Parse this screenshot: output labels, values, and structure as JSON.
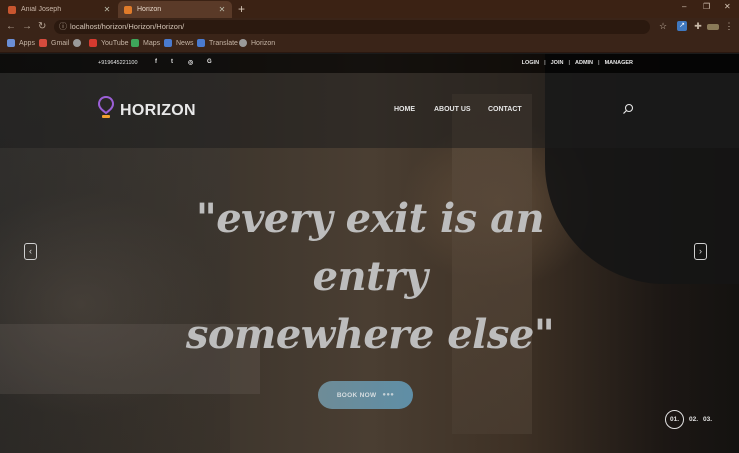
{
  "browser": {
    "tabs": [
      {
        "title": "Anial Joseph",
        "active": false,
        "favicon_color": "#c8562f"
      },
      {
        "title": "Horizon",
        "active": true,
        "favicon_color": "#e07b2a"
      }
    ],
    "new_tab": "+",
    "window_controls": {
      "minimize": "–",
      "maximize": "❐",
      "close": "✕"
    },
    "nav": {
      "back": "←",
      "forward": "→",
      "reload": "↻"
    },
    "address": {
      "info_icon": "ⓘ",
      "url": "localhost/horizon/Horizon/Horizon/"
    },
    "toolbar_icons": [
      "star-icon",
      "extension-icon",
      "puzzle-icon",
      "profile-icon",
      "menu-icon"
    ],
    "bookmarks": [
      {
        "label": "Apps",
        "icon": "apps-grid-icon",
        "color": "#6b8fd6"
      },
      {
        "label": "Gmail",
        "icon": "gmail-icon",
        "color": "#d54b3d"
      },
      {
        "label": "",
        "icon": "globe-icon",
        "color": "#9a9a9a"
      },
      {
        "label": "YouTube",
        "icon": "youtube-icon",
        "color": "#d63a2f"
      },
      {
        "label": "Maps",
        "icon": "maps-icon",
        "color": "#3ea65a"
      },
      {
        "label": "News",
        "icon": "news-icon",
        "color": "#4a7bd0"
      },
      {
        "label": "Translate",
        "icon": "translate-icon",
        "color": "#4a7bd0"
      },
      {
        "label": "Horizon",
        "icon": "globe-icon",
        "color": "#9a9a9a"
      }
    ]
  },
  "site": {
    "topbar": {
      "phone": "+919645221100",
      "social": [
        "f",
        "t",
        "◎",
        "G"
      ],
      "links": [
        "LOGIN",
        "JOIN",
        "ADMIN",
        "MANAGER"
      ],
      "separator": "|"
    },
    "brand": "HORIZON",
    "nav_links": [
      "HOME",
      "ABOUT US",
      "CONTACT"
    ],
    "hero": {
      "quote_lines": [
        "\"every exit is an",
        "entry",
        "somewhere else\""
      ],
      "book_button": "BOOK NOW",
      "book_button_dots": "●●●",
      "prev": "‹",
      "next": "›"
    },
    "pager": [
      "01.",
      "02.",
      "03."
    ]
  },
  "colors": {
    "logo_pin": "#9b5fd6",
    "logo_pin_bottom": "#f0a030",
    "button": "#6e8c97"
  }
}
